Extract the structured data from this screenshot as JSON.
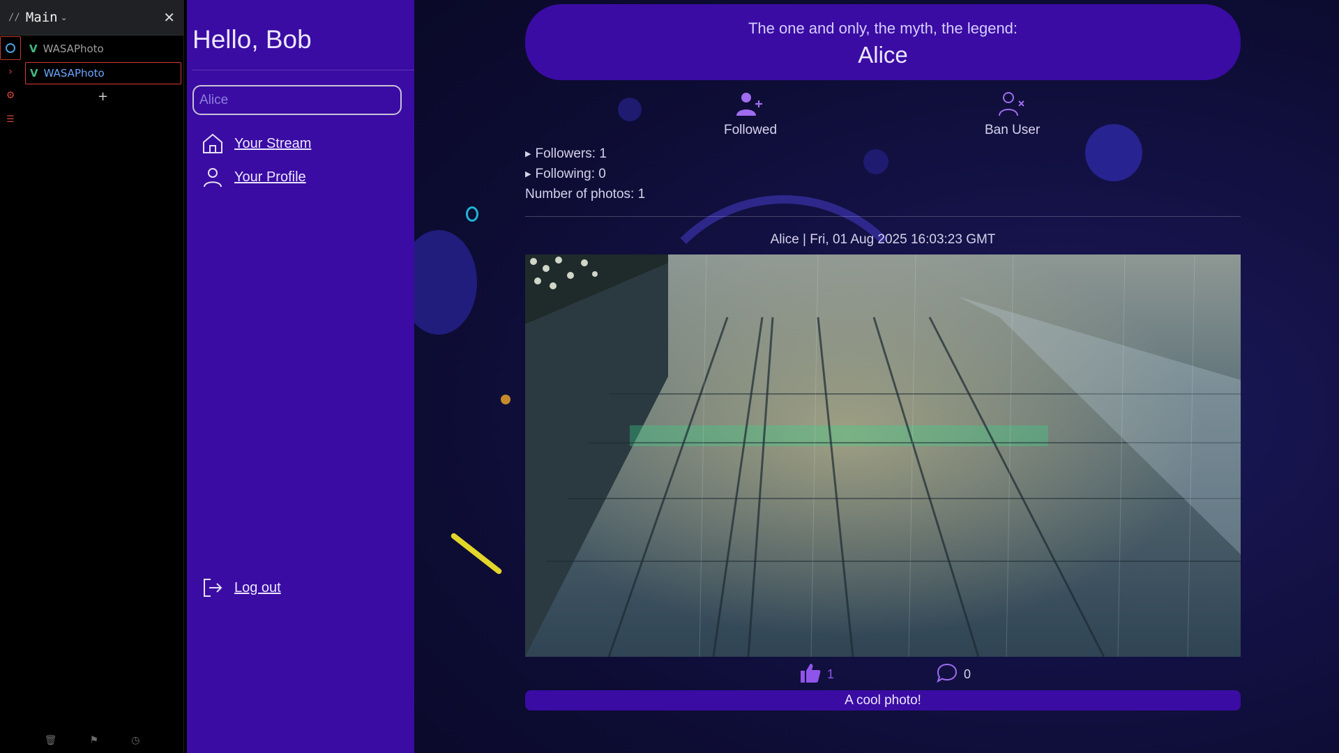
{
  "devtools": {
    "title": "Main",
    "tree": [
      {
        "label": "WASAPhoto"
      },
      {
        "label": "WASAPhoto"
      }
    ],
    "add_label": "+",
    "close_label": "✕"
  },
  "sidebar": {
    "greeting": "Hello, Bob",
    "search": {
      "value": "",
      "placeholder": "Alice"
    },
    "nav": {
      "stream": "Your Stream",
      "profile": "Your Profile",
      "logout": "Log out"
    }
  },
  "profile": {
    "tagline": "The one and only, the myth, the legend:",
    "username": "Alice",
    "follow_label": "Followed",
    "ban_label": "Ban User",
    "followers": "Followers: 1",
    "following": "Following: 0",
    "photos": "Number of photos: 1"
  },
  "post": {
    "meta": "Alice | Fri, 01 Aug 2025 16:03:23 GMT",
    "likes": "1",
    "comments": "0",
    "caption": "A cool photo!"
  },
  "colors": {
    "accent": "#3a0ca3",
    "icon_purple": "#a06cf0",
    "like_purple": "#8f55ea"
  }
}
